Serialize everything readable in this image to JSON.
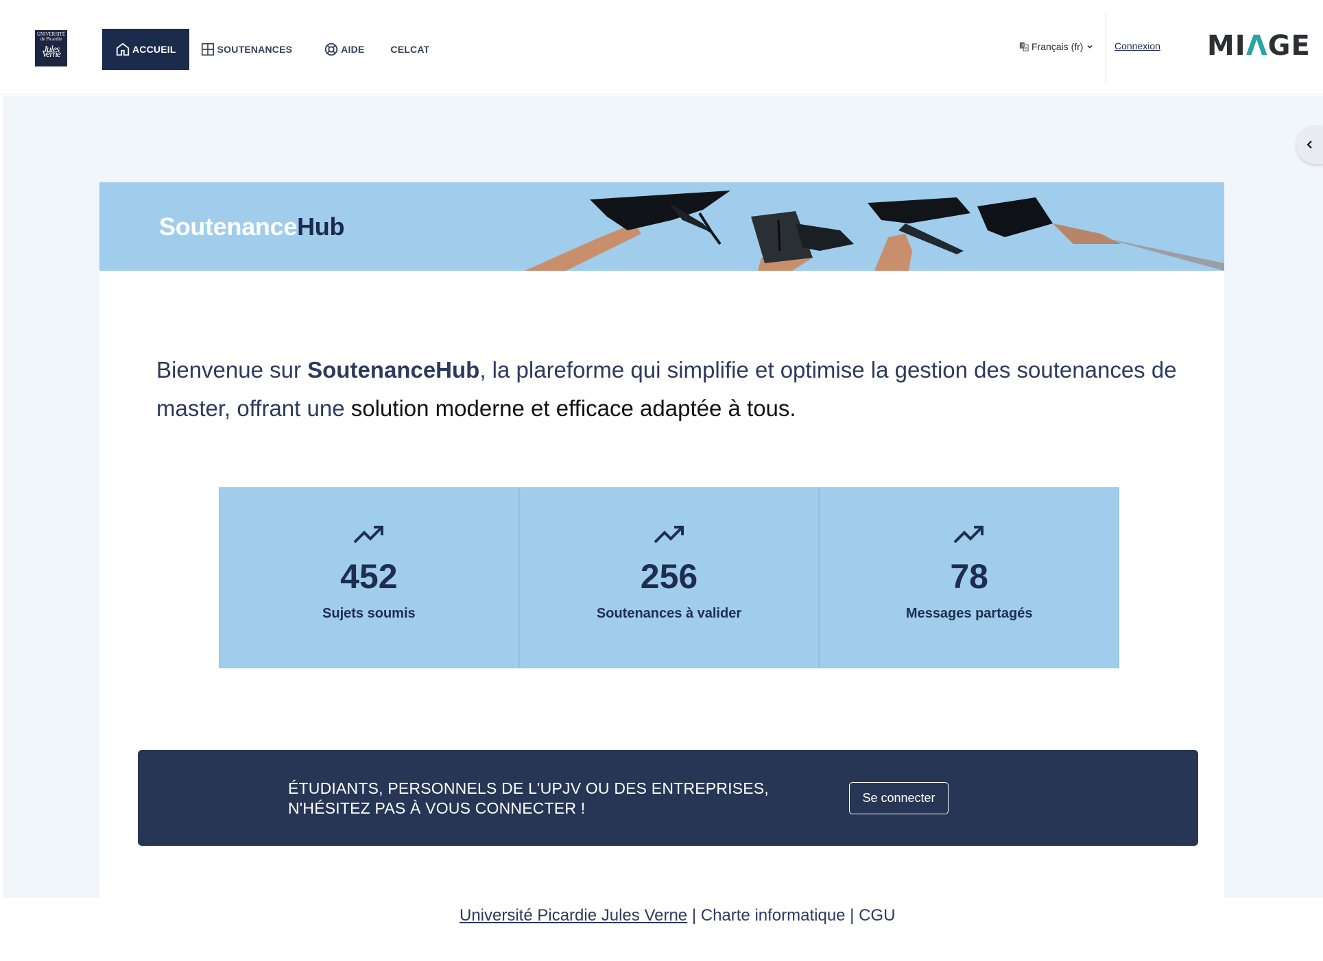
{
  "header": {
    "logo_text": "UNIVERSITÉ de Picardie",
    "logo_signature": "Jules Verne",
    "nav": [
      {
        "label": "ACCUEIL",
        "icon": "home-icon",
        "active": true
      },
      {
        "label": "SOUTENANCES",
        "icon": "grid-icon",
        "active": false
      },
      {
        "label": "AIDE",
        "icon": "lifebuoy-icon",
        "active": false
      },
      {
        "label": "CELCAT",
        "icon": "",
        "active": false
      }
    ],
    "language": "Français (fr)",
    "login_link": "Connexion",
    "brand": {
      "pre": "MI",
      "accent": "Λ",
      "post": "GE"
    }
  },
  "banner": {
    "title_part1": "Soutenance",
    "title_part2": "Hub"
  },
  "intro": {
    "part1": "Bienvenue sur ",
    "bold": "SoutenanceHub",
    "part2": ", la plareforme qui simplifie et optimise la gestion des soutenances de master, offrant une ",
    "part3": "solution moderne et efficace adaptée à tous."
  },
  "stats": [
    {
      "value": "452",
      "label": "Sujets soumis",
      "icon": "trending-up-icon"
    },
    {
      "value": "256",
      "label": "Soutenances à valider",
      "icon": "trending-up-icon"
    },
    {
      "value": "78",
      "label": "Messages partagés",
      "icon": "trending-up-icon"
    }
  ],
  "cta": {
    "line1": "ÉTUDIANTS, PERSONNELS DE L'UPJV OU DES ENTREPRISES,",
    "line2": "N'HÉSITEZ PAS À VOUS CONNECTER !",
    "button": "Se connecter"
  },
  "footer": {
    "university": "Université Picardie Jules Verne",
    "sep1": " | ",
    "charter": "Charte informatique",
    "sep2": " | ",
    "cgu": "CGU"
  },
  "colors": {
    "navy": "#1b2b4b",
    "light_blue": "#a0cdeb",
    "cta_bg": "#283655",
    "page_bg": "#f1f6fa"
  }
}
